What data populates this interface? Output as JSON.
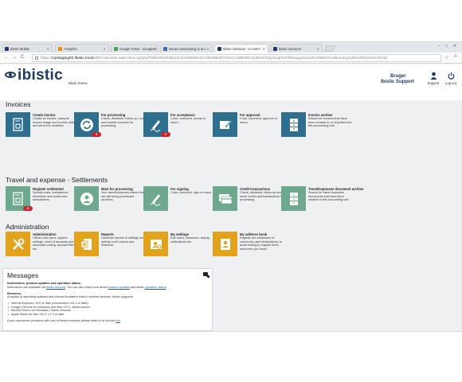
{
  "browser": {
    "tabs": [
      {
        "label": "Ibistic Mobile"
      },
      {
        "label": "Analytics"
      },
      {
        "label": "Google Fotos - Google D"
      },
      {
        "label": "Issues associating to an i"
      },
      {
        "label": "Ibistic Services - e-comm"
      },
      {
        "label": "Ibistic Services"
      }
    ],
    "address": {
      "protocol": "https://",
      "host": "lcpstaging02.ibistic.local",
      "path": "/MR/AspxHost.aspx?key=Ig2ptyPWtWoBWfs3bj1hUUNHBtlWNGZJkR8MoR7NZxV1SBEt0hCbqR0Zrh2fyUUqfsI2hP0sxgqnOpKis%2bBOV%2BuexKgvyhRoWlXX4mVvRGqf"
    },
    "controls": {
      "back": "←",
      "forward": "→",
      "reload": "C",
      "star": "☆",
      "menu": "≡"
    }
  },
  "header": {
    "logo_text": "ibistic",
    "main_menu": "Main menu",
    "user_line1": "Bruger",
    "user_line2": "Ibistic Support",
    "support_label": "Support",
    "logout_label": "Log out"
  },
  "sections": {
    "invoices": "Invoices",
    "travel": "Travel and expense - Settlements",
    "admin": "Administration"
  },
  "tiles": {
    "create_invoice": {
      "title": "Create invoice",
      "desc": "Create an invoice, using an invoice image and invoice data, and send it to workflow."
    },
    "for_processing": {
      "title": "For processing",
      "desc": "Check, distribute, follow up, code and transfer invoices for processing.",
      "badge": "1"
    },
    "for_acceptance": {
      "title": "For acceptance",
      "desc": "Code, comment, accept or return.",
      "badge": "1"
    },
    "for_approval": {
      "title": "For approval",
      "desc": "Code, comment, approve or return."
    },
    "invoice_archive": {
      "title": "Invoice archive",
      "desc": "Search for invoices that have been created in, or imported into, this accounting unit."
    },
    "register_settlement": {
      "title": "Register settlement",
      "desc": "Specify costs, subsistence, kilometres and credit card transactions.",
      "badge": "4"
    },
    "mine_for_processing": {
      "title": "Mine for processing",
      "desc": "Your travel/expenses claims that are still being processed (archive)."
    },
    "for_signing": {
      "title": "For signing",
      "desc": "Code, comment, sign or return."
    },
    "credit_transactions": {
      "title": "Credit transactions",
      "desc": "Check, distribute, follow up and move credit card transactions for processing."
    },
    "travel_archive": {
      "title": "Travel/expenses document archive",
      "desc": "Search for travel expenses documents that have been created in this accounting unit."
    },
    "administration": {
      "title": "Administration",
      "desc": "Offices and users, system settings, chart of accounts and automatic coding, account filters, etc."
    },
    "reports": {
      "title": "Reports",
      "desc": "Generate reports of settings and activity, both current and historical."
    },
    "my_settings": {
      "title": "My settings",
      "desc": "Edit name, password, deputy, notifications etc."
    },
    "address_book": {
      "title": "My address book",
      "desc": "Register the addresses of commonly used destinations, to avoid having to register them each time you travel."
    }
  },
  "messages": {
    "title": "Messages",
    "h1": "Instructions, product updates and operation status",
    "p1_a": "Instructions are available via ",
    "p1_link1": "Ibistic Support",
    "p1_b": ". You can also read more about ",
    "p1_link2": "product updates",
    "p1_c": " and latest ",
    "p1_link3": "operation status",
    "p1_d": ".",
    "h2": "Browsers",
    "p2": "A myriad of operating systems and Internet browsers exits in several versions. Ibistic supports:",
    "browsers": [
      "Internet Explorer, v9.0 or later (recommend v11.0 or later)",
      "Google Chrome for Windows and Mac OS X, latest version",
      "Mozilla Firefox for Windows 2 latest versions",
      "Apple Safari for Mac OS X, v7.0 or later"
    ],
    "p3_a": "If you experience problems with one of these browsers please write to us via this ",
    "p3_link": "link"
  },
  "colors": {
    "brand": "#1d3b66",
    "tile_blue": "#2e6e8e",
    "tile_green": "#6ea88f",
    "tile_orange": "#e2a21c",
    "badge_red": "#c9242b"
  }
}
